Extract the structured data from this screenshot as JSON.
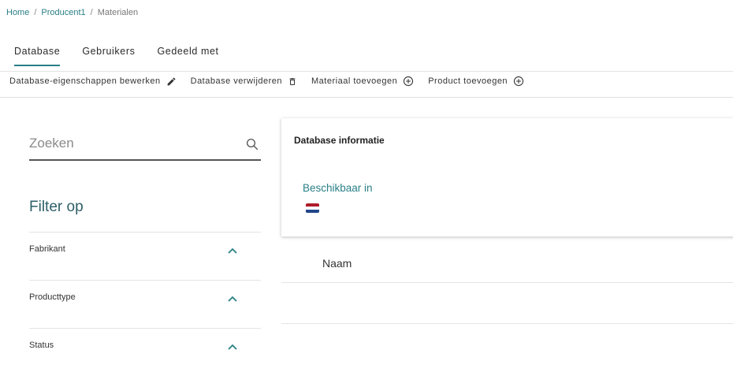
{
  "breadcrumb": {
    "home": "Home",
    "producer": "Producent1",
    "current": "Materialen",
    "separator": "/"
  },
  "tabs": [
    {
      "label": "Database",
      "active": true
    },
    {
      "label": "Gebruikers",
      "active": false
    },
    {
      "label": "Gedeeld met",
      "active": false
    }
  ],
  "toolbar": {
    "edit_label": "Database-eigenschappen bewerken",
    "delete_label": "Database verwijderen",
    "add_material_label": "Materiaal toevoegen",
    "add_product_label": "Product toevoegen"
  },
  "search": {
    "placeholder": "Zoeken"
  },
  "filter": {
    "title": "Filter op",
    "groups": [
      {
        "label": "Fabrikant"
      },
      {
        "label": "Producttype"
      },
      {
        "label": "Status"
      }
    ]
  },
  "info_card": {
    "title": "Database informatie",
    "available_label": "Beschikbaar in",
    "flag": "netherlands-flag"
  },
  "table": {
    "column_name": "Naam"
  },
  "colors": {
    "accent": "#2a7f86",
    "flag_red": "#ae1c28",
    "flag_white": "#ffffff",
    "flag_blue": "#21468b"
  }
}
